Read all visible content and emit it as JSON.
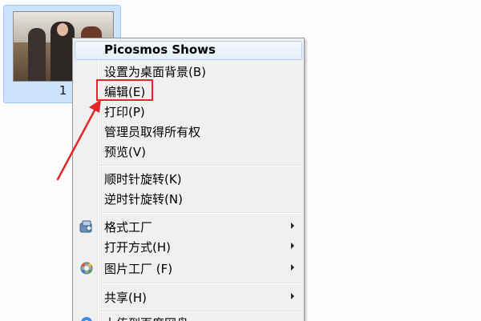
{
  "file": {
    "label": "1"
  },
  "menu": {
    "items": [
      {
        "label": "Picosmos Shows"
      },
      {
        "label": "设置为桌面背景(B)"
      },
      {
        "label": "编辑(E)"
      },
      {
        "label": "打印(P)"
      },
      {
        "label": "管理员取得所有权"
      },
      {
        "label": "预览(V)"
      },
      {
        "label": "顺时针旋转(K)"
      },
      {
        "label": "逆时针旋转(N)"
      },
      {
        "label": "格式工厂",
        "icon": "format-factory-icon"
      },
      {
        "label": "打开方式(H)"
      },
      {
        "label": "图片工厂 (F)",
        "icon": "picture-factory-icon"
      },
      {
        "label": "共享(H)"
      },
      {
        "label": "上传到百度网盘",
        "icon": "baidu-netdisk-icon"
      }
    ]
  },
  "annotation": {
    "highlight_color": "#e2262c"
  }
}
